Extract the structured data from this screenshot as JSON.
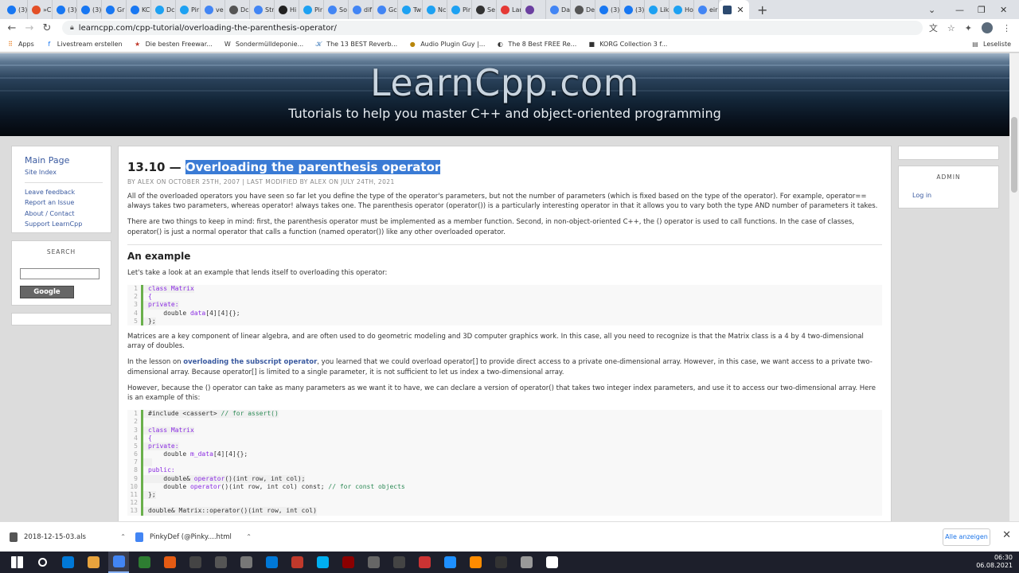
{
  "browser": {
    "tabs": [
      {
        "label": "(3)",
        "color": "#1877f2"
      },
      {
        "label": "»C",
        "color": "#e34f26"
      },
      {
        "label": "(3)",
        "color": "#1877f2"
      },
      {
        "label": "(3)",
        "color": "#1877f2"
      },
      {
        "label": "Gr",
        "color": "#1877f2"
      },
      {
        "label": "KC",
        "color": "#1877f2"
      },
      {
        "label": "Dc",
        "color": "#1da1f2"
      },
      {
        "label": "Pir",
        "color": "#1da1f2"
      },
      {
        "label": "ve",
        "color": "#4285f4"
      },
      {
        "label": "Dc",
        "color": "#555555"
      },
      {
        "label": "Str",
        "color": "#4285f4"
      },
      {
        "label": "Hi",
        "color": "#222222"
      },
      {
        "label": "Pir",
        "color": "#1da1f2"
      },
      {
        "label": "So",
        "color": "#4285f4"
      },
      {
        "label": "dif",
        "color": "#4285f4"
      },
      {
        "label": "Gc",
        "color": "#4285f4"
      },
      {
        "label": "Tw",
        "color": "#1da1f2"
      },
      {
        "label": "Nc",
        "color": "#1da1f2"
      },
      {
        "label": "Pir",
        "color": "#1da1f2"
      },
      {
        "label": "Se",
        "color": "#333333"
      },
      {
        "label": "Lar",
        "color": "#e53935"
      },
      {
        "label": "",
        "color": "#6b3fa0"
      },
      {
        "label": "Da",
        "color": "#4285f4"
      },
      {
        "label": "De",
        "color": "#555555"
      },
      {
        "label": "(3)",
        "color": "#1877f2"
      },
      {
        "label": "(3)",
        "color": "#1877f2"
      },
      {
        "label": "Lik",
        "color": "#1da1f2"
      },
      {
        "label": "Ho",
        "color": "#1da1f2"
      },
      {
        "label": "eir",
        "color": "#4285f4"
      }
    ],
    "active_tab_color": "#2c4a70",
    "url": "learncpp.com/cpp-tutorial/overloading-the-parenthesis-operator/",
    "bookmarks": [
      {
        "label": "Apps",
        "color": "#e8710a",
        "glyph": "⠿"
      },
      {
        "label": "Livestream erstellen",
        "color": "#1877f2",
        "glyph": "f"
      },
      {
        "label": "Die besten Freewar...",
        "color": "#c0392b",
        "glyph": "★"
      },
      {
        "label": "Sondermülldeponie...",
        "color": "#333333",
        "glyph": "W"
      },
      {
        "label": "The 13 BEST Reverb...",
        "color": "#2c6fb5",
        "glyph": "𝒦"
      },
      {
        "label": "Audio Plugin Guy |...",
        "color": "#b8860b",
        "glyph": "●"
      },
      {
        "label": "The 8 Best FREE Re...",
        "color": "#333333",
        "glyph": "◐"
      },
      {
        "label": "KORG Collection 3 f...",
        "color": "#333333",
        "glyph": "■"
      }
    ],
    "reading_list": "Leseliste"
  },
  "site": {
    "title": "LearnCpp.com",
    "tagline": "Tutorials to help you master C++ and object-oriented programming"
  },
  "sidebar": {
    "main_page": "Main Page",
    "site_index": "Site Index",
    "links": [
      "Leave feedback",
      "Report an Issue",
      "About / Contact",
      "Support LearnCpp"
    ],
    "search_heading": "SEARCH",
    "search_value": "",
    "search_button": "Google Search"
  },
  "admin": {
    "heading": "ADMIN",
    "login": "Log in"
  },
  "article": {
    "number": "13.10 —",
    "title": "Overloading the parenthesis operator",
    "byline": "BY ALEX ON OCTOBER 25TH, 2007 | LAST MODIFIED BY ALEX ON JULY 24TH, 2021",
    "p1": "All of the overloaded operators you have seen so far let you define the type of the operator's parameters, but not the number of parameters (which is fixed based on the type of the operator). For example, operator== always takes two parameters, whereas operator! always takes one. The parenthesis operator (operator()) is a particularly interesting operator in that it allows you to vary both the type AND number of parameters it takes.",
    "p2": "There are two things to keep in mind: first, the parenthesis operator must be implemented as a member function. Second, in non-object-oriented C++, the () operator is used to call functions. In the case of classes, operator() is just a normal operator that calls a function (named operator()) like any other overloaded operator.",
    "example_heading": "An example",
    "p3": "Let's take a look at an example that lends itself to overloading this operator:",
    "p4": "Matrices are a key component of linear algebra, and are often used to do geometric modeling and 3D computer graphics work. In this case, all you need to recognize is that the Matrix class is a 4 by 4 two-dimensional array of doubles.",
    "p5_before": "In the lesson on ",
    "p5_link": "overloading the subscript operator",
    "p5_after": ", you learned that we could overload operator[] to provide direct access to a private one-dimensional array. However, in this case, we want access to a private two-dimensional array. Because operator[] is limited to a single parameter, it is not sufficient to let us index a two-dimensional array.",
    "p6": "However, because the () operator can take as many parameters as we want it to have, we can declare a version of operator() that takes two integer index parameters, and use it to access our two-dimensional array. Here is an example of this:",
    "code1": [
      {
        "ln": "1",
        "tokens": [
          {
            "t": "class ",
            "c": "kw"
          },
          {
            "t": "Matrix",
            "c": "ty"
          }
        ]
      },
      {
        "ln": "2",
        "tokens": [
          {
            "t": "{",
            "c": "kw"
          }
        ]
      },
      {
        "ln": "3",
        "tokens": [
          {
            "t": "private:",
            "c": "kw"
          }
        ]
      },
      {
        "ln": "4",
        "tokens": [
          {
            "t": "    double ",
            "c": ""
          },
          {
            "t": "data",
            "c": "ty"
          },
          {
            "t": "[4][4]{};",
            "c": ""
          }
        ]
      },
      {
        "ln": "5",
        "tokens": [
          {
            "t": "};",
            "c": ""
          }
        ]
      }
    ],
    "code2": [
      {
        "ln": "1",
        "tokens": [
          {
            "t": "#include <cassert> ",
            "c": ""
          },
          {
            "t": "// for assert()",
            "c": "cm"
          }
        ]
      },
      {
        "ln": "2",
        "tokens": []
      },
      {
        "ln": "3",
        "tokens": [
          {
            "t": "class ",
            "c": "kw"
          },
          {
            "t": "Matrix",
            "c": "ty"
          }
        ]
      },
      {
        "ln": "4",
        "tokens": [
          {
            "t": "{",
            "c": "kw"
          }
        ]
      },
      {
        "ln": "5",
        "tokens": [
          {
            "t": "private:",
            "c": "kw"
          }
        ]
      },
      {
        "ln": "6",
        "tokens": [
          {
            "t": "    double ",
            "c": ""
          },
          {
            "t": "m_data",
            "c": "ty"
          },
          {
            "t": "[4][4]{};",
            "c": ""
          }
        ]
      },
      {
        "ln": "7",
        "tokens": []
      },
      {
        "ln": "8",
        "tokens": [
          {
            "t": "public:",
            "c": "kw"
          }
        ]
      },
      {
        "ln": "9",
        "tokens": [
          {
            "t": "    double& ",
            "c": ""
          },
          {
            "t": "operator",
            "c": "kw"
          },
          {
            "t": "()(int row, int col);",
            "c": ""
          }
        ]
      },
      {
        "ln": "10",
        "tokens": [
          {
            "t": "    double ",
            "c": ""
          },
          {
            "t": "operator",
            "c": "kw"
          },
          {
            "t": "()(int row, int col) const; ",
            "c": ""
          },
          {
            "t": "// for const objects",
            "c": "cm"
          }
        ]
      },
      {
        "ln": "11",
        "tokens": [
          {
            "t": "};",
            "c": ""
          }
        ]
      },
      {
        "ln": "12",
        "tokens": []
      },
      {
        "ln": "13",
        "tokens": [
          {
            "t": "double& Matrix::operator()(int row, int col)",
            "c": ""
          }
        ]
      }
    ]
  },
  "downloads": {
    "items": [
      {
        "name": "2018-12-15-03.als",
        "color": "#555555"
      },
      {
        "name": "PinkyDef (@Pinky....html",
        "color": "#4285f4"
      }
    ],
    "show_all": "Alle anzeigen"
  },
  "taskbar": {
    "apps": [
      "#ffffff",
      "#ffffff",
      "#0078d7",
      "#e8a33d",
      "#4285f4",
      "#2e7d32",
      "#e55b13",
      "#444444",
      "#555555",
      "#777777",
      "#0078d7",
      "#c0392b",
      "#00aff0",
      "#8b0000",
      "#666666",
      "#444444",
      "#cc3333",
      "#1e90ff",
      "#ff8c00",
      "#333333",
      "#999999",
      "#ffffff"
    ],
    "active_index": 4,
    "time": "06:30",
    "date": "06.08.2021"
  }
}
